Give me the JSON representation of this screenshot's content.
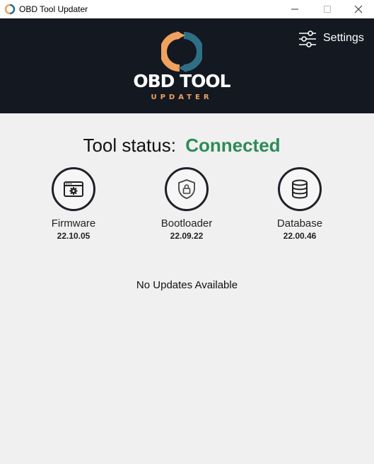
{
  "window": {
    "title": "OBD Tool Updater",
    "controls": [
      "minimize-icon",
      "maximize-icon",
      "close-icon"
    ]
  },
  "header": {
    "logo_title": "OBD TOOL",
    "logo_subtitle": "UPDATER",
    "settings_label": "Settings",
    "colors": {
      "background": "#131821",
      "accent_orange": "#f0a25e",
      "accent_teal": "#2f6f86"
    }
  },
  "status": {
    "label": "Tool status:",
    "value": "Connected",
    "value_color": "#2e8b57"
  },
  "items": [
    {
      "name": "Firmware",
      "version": "22.10.05",
      "icon": "firmware-window-gear-icon"
    },
    {
      "name": "Bootloader",
      "version": "22.09.22",
      "icon": "shield-lock-icon"
    },
    {
      "name": "Database",
      "version": "22.00.46",
      "icon": "database-icon"
    }
  ],
  "message": "No Updates Available"
}
